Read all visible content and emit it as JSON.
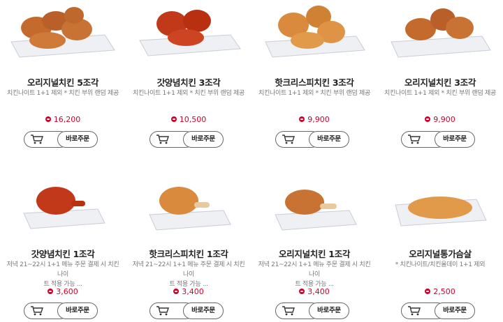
{
  "colors": {
    "price": "#d4002a",
    "title": "#222222",
    "desc": "#777777",
    "border": "#666666"
  },
  "icons": {
    "cart": "cart-icon",
    "price": "price-coin-icon"
  },
  "products": [
    {
      "name": "오리지널치킨 5조각",
      "desc_lines": [
        "치킨나이트 1+1 제외 * 치킨 부위 랜덤 제공"
      ],
      "price": "16,200",
      "order_label": "바로주문",
      "photo": "fried-chicken-5pc"
    },
    {
      "name": "갓양념치킨 3조각",
      "desc_lines": [
        "치킨나이트 1+1 제외 * 치킨 부위 랜덤 제공"
      ],
      "price": "10,500",
      "order_label": "바로주문",
      "photo": "sauced-chicken-3pc"
    },
    {
      "name": "핫크리스피치킨 3조각",
      "desc_lines": [
        "치킨나이트 1+1 제외 * 치킨 부위 랜덤 제공"
      ],
      "price": "9,900",
      "order_label": "바로주문",
      "photo": "crispy-chicken-3pc"
    },
    {
      "name": "오리지널치킨 3조각",
      "desc_lines": [
        "치킨나이트 1+1 제외 * 치킨 부위 랜덤 제공"
      ],
      "price": "9,900",
      "order_label": "바로주문",
      "photo": "fried-chicken-3pc"
    },
    {
      "name": "갓양념치킨 1조각",
      "desc_lines": [
        "저녁 21~22시 1+1 메뉴 주문 결제 시 치킨나이",
        "트 적용 가능 ..."
      ],
      "price": "3,600",
      "order_label": "바로주문",
      "photo": "sauced-chicken-1pc"
    },
    {
      "name": "핫크리스피치킨 1조각",
      "desc_lines": [
        "저녁 21~22시 1+1 메뉴 주문 결제 시 치킨나이",
        "트 적용 가능 ..."
      ],
      "price": "3,400",
      "order_label": "바로주문",
      "photo": "crispy-chicken-1pc"
    },
    {
      "name": "오리지널치킨 1조각",
      "desc_lines": [
        "저녁 21~22시 1+1 메뉴 주문 결제 시 치킨나이",
        "트 적용 가능 ..."
      ],
      "price": "3,400",
      "order_label": "바로주문",
      "photo": "fried-chicken-1pc"
    },
    {
      "name": "오리지널통가슴살",
      "desc_lines": [
        "* 치킨나이트/치킨올데이 1+1 제외"
      ],
      "price": "2,500",
      "order_label": "바로주문",
      "photo": "chicken-breast-fillet"
    }
  ]
}
